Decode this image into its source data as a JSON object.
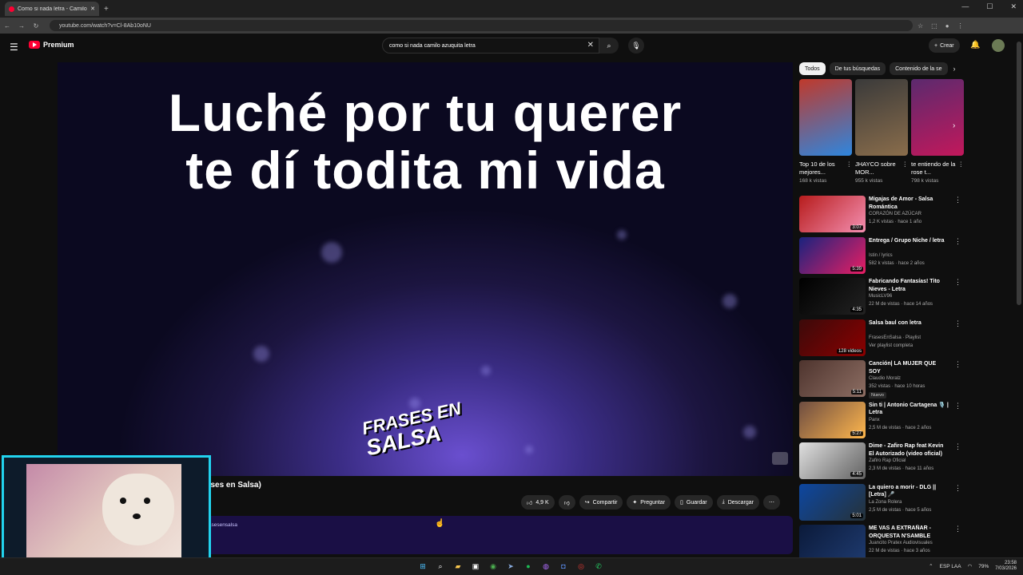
{
  "browser": {
    "tab_title": "Como si nada letra - Camilo",
    "new_tab": "+",
    "url": "youtube.com/watch?v=Cl-8Ab10oNU",
    "window_controls": [
      "—",
      "☐",
      "✕"
    ]
  },
  "header": {
    "logo_text": "Premium",
    "search_query": "como si nada camilo azuquita letra",
    "create_label": "Crear"
  },
  "player": {
    "lyric_line1": "Luché por tu querer",
    "lyric_line2": "te dí todita mi vida",
    "brand_line1": "FRASES EN",
    "brand_line2": "SALSA"
  },
  "video": {
    "title_visible": "uita (Frases en Salsa)",
    "actions": {
      "likes": "4,9 K",
      "share": "Compartir",
      "ask": "Preguntar",
      "save": "Guardar",
      "download": "Descargar",
      "more": "⋯"
    },
    "description_snippet": "marafann  #frasesensalsa"
  },
  "sidebar": {
    "chips": [
      "Todos",
      "De tus búsquedas",
      "Contenido de la se"
    ],
    "shorts": [
      {
        "title": "Top 10 de los mejores...",
        "views": "168 k vistas",
        "colors": [
          "#c0392b",
          "#2e86de"
        ]
      },
      {
        "title": "JHAYCO sobre MOR...",
        "views": "955 k vistas",
        "colors": [
          "#3a3a3a",
          "#8a6d4b"
        ]
      },
      {
        "title": "te entiendo de la rose t...",
        "views": "798 k vistas",
        "colors": [
          "#5b2a6e",
          "#c2185b"
        ]
      }
    ],
    "videos": [
      {
        "title": "Migajas de Amor - Salsa Romántica",
        "channel": "CORAZÓN DE AZÚCAR",
        "meta": "1,2 K vistas · hace 1 año",
        "duration": "3:07",
        "colors": [
          "#b71c1c",
          "#f48fb1"
        ]
      },
      {
        "title": "Entrega / Grupo Niche / letra",
        "channel": "Istin / lyrics",
        "meta": "582 k vistas · hace 2 años",
        "duration": "5:39",
        "colors": [
          "#1a237e",
          "#e91e63"
        ]
      },
      {
        "title": "Fabricando Fantasías! Tito Nieves - Letra",
        "channel": "MusicLV96",
        "meta": "22 M de vistas · hace 14 años",
        "duration": "4:35",
        "colors": [
          "#000000",
          "#222222"
        ]
      },
      {
        "title": "Salsa baul con letra",
        "channel": "FrasesEnSalsa · Playlist",
        "meta": "Ver playlist completa",
        "duration": "128 videos",
        "colors": [
          "#3b0a0a",
          "#8b0000"
        ]
      },
      {
        "title": "Canción| LA MUJER QUE SOY",
        "channel": "Claudio Moralz",
        "meta": "352 vistas · hace 10 horas",
        "badge": "Nuevo",
        "duration": "5:11",
        "colors": [
          "#4e342e",
          "#8d6e63"
        ]
      },
      {
        "title": "Sin ti | Antonio Cartagena 🎙️ | Letra",
        "channel": "Panx",
        "meta": "2,5 M de vistas · hace 2 años",
        "duration": "5:27",
        "colors": [
          "#6d4c41",
          "#ffb74d"
        ]
      },
      {
        "title": "Dime - Zafiro Rap feat Kevin El Autorizado (video oficial)",
        "channel": "Zafiro Rap Oficial",
        "meta": "2,3 M de vistas · hace 11 años",
        "duration": "4:45",
        "colors": [
          "#e0e0e0",
          "#616161"
        ]
      },
      {
        "title": "La quiero a morir - DLG || [Letra] 🎤",
        "channel": "La Zona Rolera",
        "meta": "2,5 M de vistas · hace 5 años",
        "duration": "5:01",
        "colors": [
          "#0d47a1",
          "#263238"
        ]
      },
      {
        "title": "ME VAS A EXTRAÑAR - ORQUESTA N'SAMBLE (Estren...",
        "channel": "Juancito Pratex Audiovisuales",
        "meta": "22 M de vistas · hace 3 años",
        "duration": "",
        "colors": [
          "#0b1a3a",
          "#1e3a6e"
        ]
      }
    ]
  },
  "taskbar": {
    "lang": "ESP LAA",
    "battery": "79%",
    "time": "23:58",
    "date": "7/03/2026"
  }
}
